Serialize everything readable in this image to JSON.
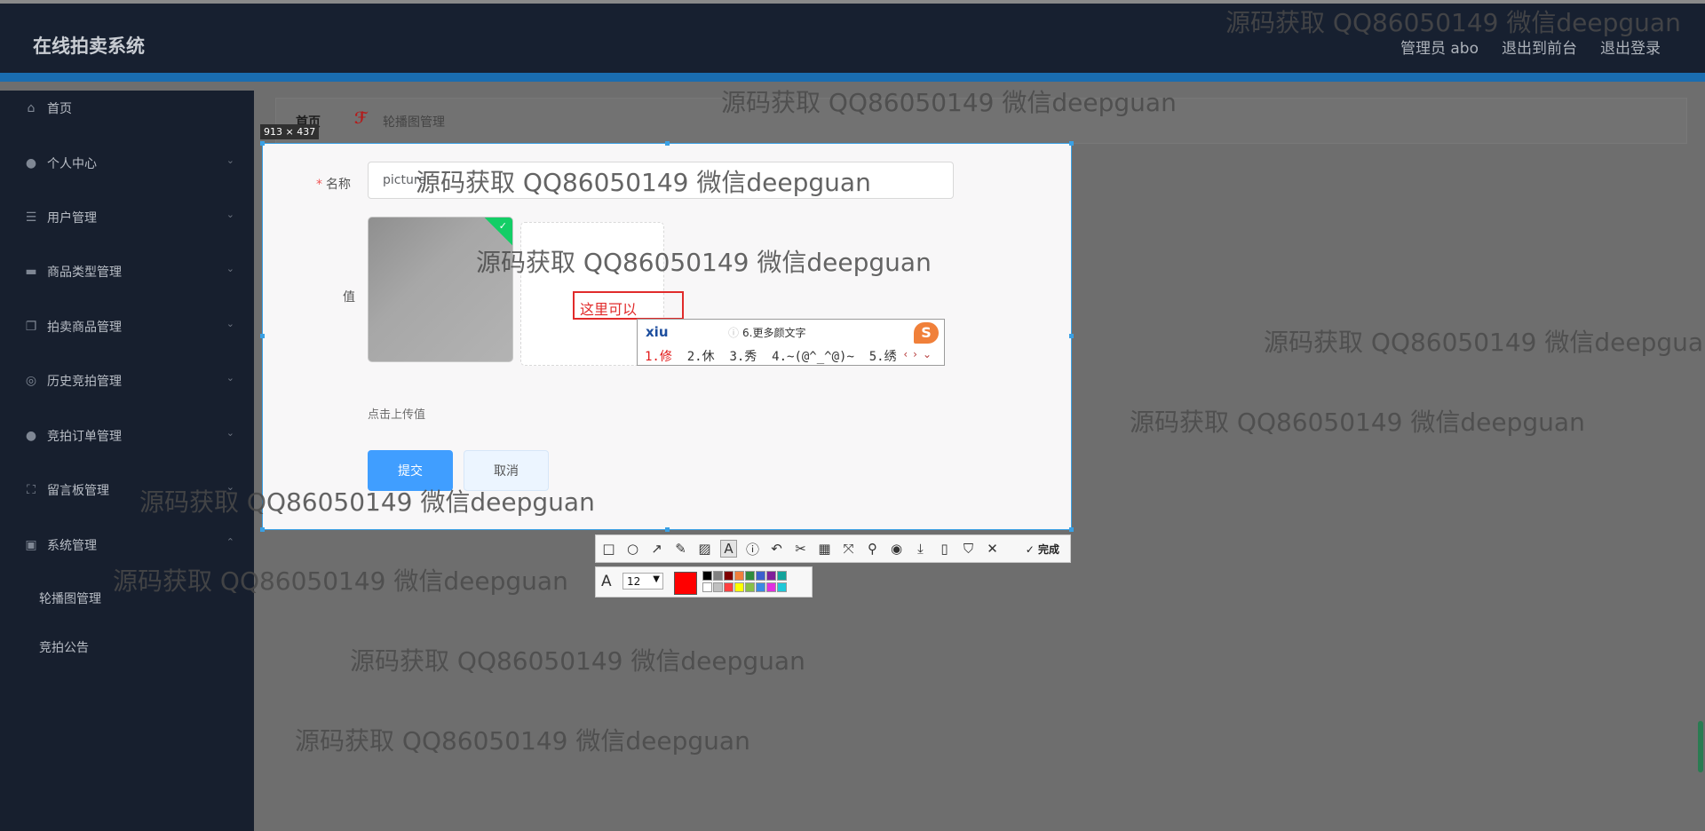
{
  "header": {
    "app_title": "在线拍卖系统",
    "links": [
      "管理员 abo",
      "退出到前台",
      "退出登录"
    ]
  },
  "sidebar": {
    "items": [
      {
        "label": "首页",
        "icon": "home-icon"
      },
      {
        "label": "个人中心",
        "icon": "user-icon"
      },
      {
        "label": "用户管理",
        "icon": "sliders-icon"
      },
      {
        "label": "商品类型管理",
        "icon": "monitor-icon"
      },
      {
        "label": "拍卖商品管理",
        "icon": "copy-icon"
      },
      {
        "label": "历史竞拍管理",
        "icon": "compass-icon"
      },
      {
        "label": "竞拍订单管理",
        "icon": "user-icon"
      },
      {
        "label": "留言板管理",
        "icon": "scan-icon"
      },
      {
        "label": "系统管理",
        "icon": "clipboard-icon"
      }
    ],
    "submenu": [
      "轮播图管理",
      "竞拍公告"
    ]
  },
  "breadcrumb": {
    "home": "首页",
    "separator": "ℱ",
    "current": "轮播图管理"
  },
  "screenshot_tool": {
    "selection_size": "913 × 437",
    "done_label": "完成",
    "font_size": "12",
    "current_color": "#ff0000",
    "palette_top": [
      "#000000",
      "#808080",
      "#800000",
      "#f07f3c",
      "#2e8b3e",
      "#3a5fcd",
      "#7f1f9a",
      "#13a39b"
    ],
    "palette_bottom": [
      "#ffffff",
      "#c0c0c0",
      "#ff4040",
      "#ffff00",
      "#88c047",
      "#3a8ae4",
      "#e030e0",
      "#20c8d8"
    ]
  },
  "form": {
    "name_label": "名称",
    "name_required": "*",
    "name_value": "picture",
    "value_label": "值",
    "annotation_text": "这里可以",
    "upload_hint": "点击上传值",
    "submit_label": "提交",
    "cancel_label": "取消"
  },
  "ime": {
    "pinyin": "xiu",
    "more": "6.更多颜文字",
    "more_icon": "ⓘ",
    "candidates": [
      "1.修",
      "2.休",
      "3.秀",
      "4.~(@^_^@)~",
      "5.绣"
    ],
    "logo": "S"
  },
  "watermark_text": "源码获取 QQ86050149 微信deepguan"
}
